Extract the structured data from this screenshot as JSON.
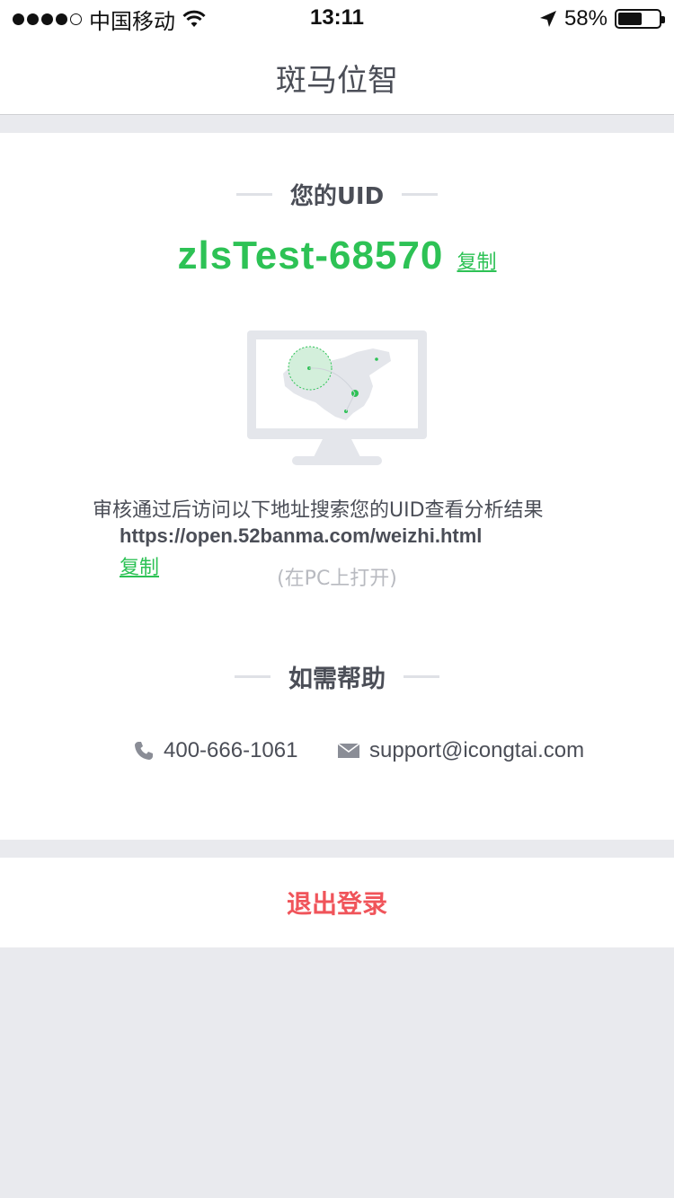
{
  "status_bar": {
    "carrier": "中国移动",
    "time": "13:11",
    "battery_percent": "58%",
    "battery_level": 0.58,
    "icons": [
      "signal-dots-icon",
      "wifi-icon",
      "location-arrow-icon",
      "battery-icon"
    ]
  },
  "nav": {
    "title": "斑马位智"
  },
  "uid_section": {
    "heading": "您的UID",
    "uid": "zlsTest-68570",
    "copy_label": "复制"
  },
  "instructions": {
    "text": "审核通过后访问以下地址搜索您的UID查看分析结果",
    "url": "https://open.52banma.com/weizhi.html",
    "copy_label": "复制",
    "pc_note": "(在PC上打开)"
  },
  "help_section": {
    "heading": "如需帮助",
    "phone": "400-666-1061",
    "email": "support@icongtai.com"
  },
  "logout": {
    "label": "退出登录"
  },
  "colors": {
    "accent_green": "#2dc255",
    "danger_red": "#f0545a",
    "text_dark": "#4b4e57",
    "muted": "#b8bac0",
    "background": "#e9eaee"
  }
}
